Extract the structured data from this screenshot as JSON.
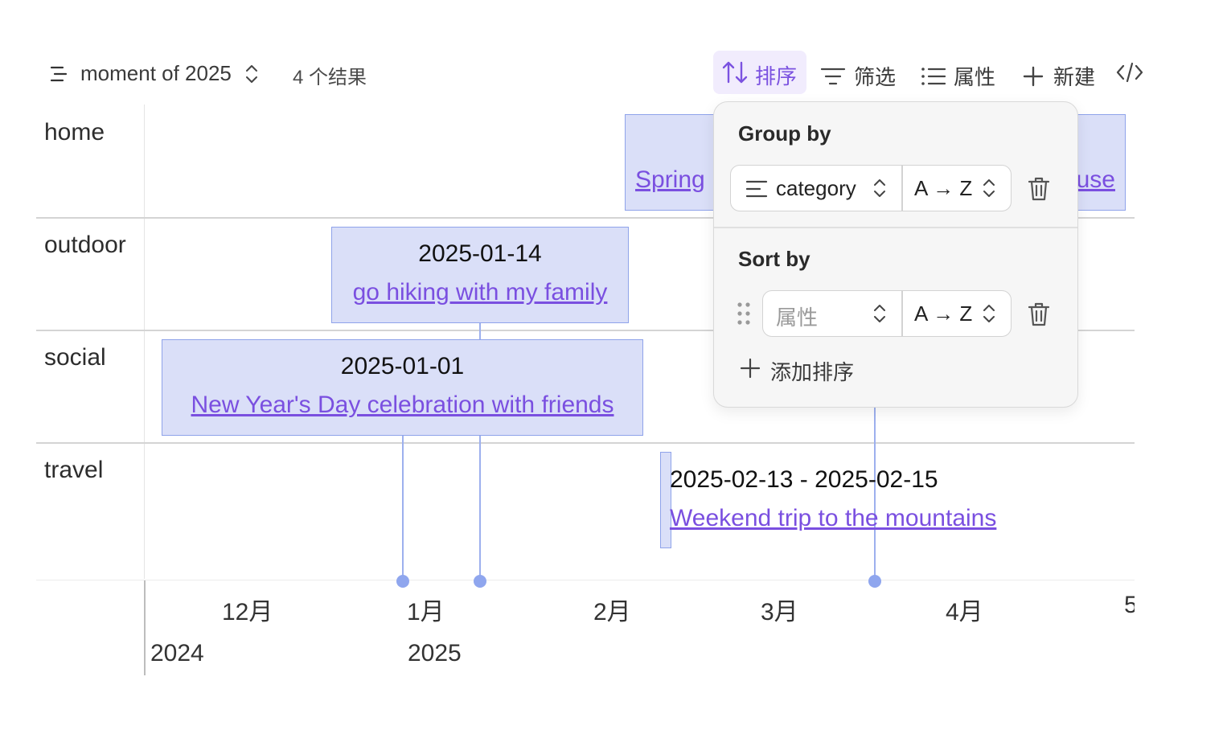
{
  "toolbar": {
    "view_name": "moment of 2025",
    "result_count": "4 个结果",
    "sort_label": "排序",
    "filter_label": "筛选",
    "properties_label": "属性",
    "new_label": "新建",
    "code_icon": "code-icon",
    "accent_color": "#7b52e0"
  },
  "groups": [
    {
      "label": "home"
    },
    {
      "label": "outdoor"
    },
    {
      "label": "social"
    },
    {
      "label": "travel"
    }
  ],
  "events": [
    {
      "group": "home",
      "title_left": "Spring",
      "title_right": "use"
    },
    {
      "group": "outdoor",
      "date": "2025-01-14",
      "title": "go hiking with my family"
    },
    {
      "group": "social",
      "date": "2025-01-01",
      "title": "New Year's Day celebration with friends"
    },
    {
      "group": "travel",
      "date": "2025-02-13 - 2025-02-15",
      "title": "Weekend trip to the mountains"
    }
  ],
  "axis": {
    "months": [
      "12月",
      "1月",
      "2月",
      "3月",
      "4月",
      "5"
    ],
    "years": [
      "2024",
      "2025"
    ]
  },
  "popover": {
    "group_by_heading": "Group by",
    "group_by_field": "category",
    "group_by_order": "A → Z",
    "sort_by_heading": "Sort by",
    "sort_by_placeholder": "属性",
    "sort_by_order": "A → Z",
    "add_sort_label": "添加排序"
  }
}
